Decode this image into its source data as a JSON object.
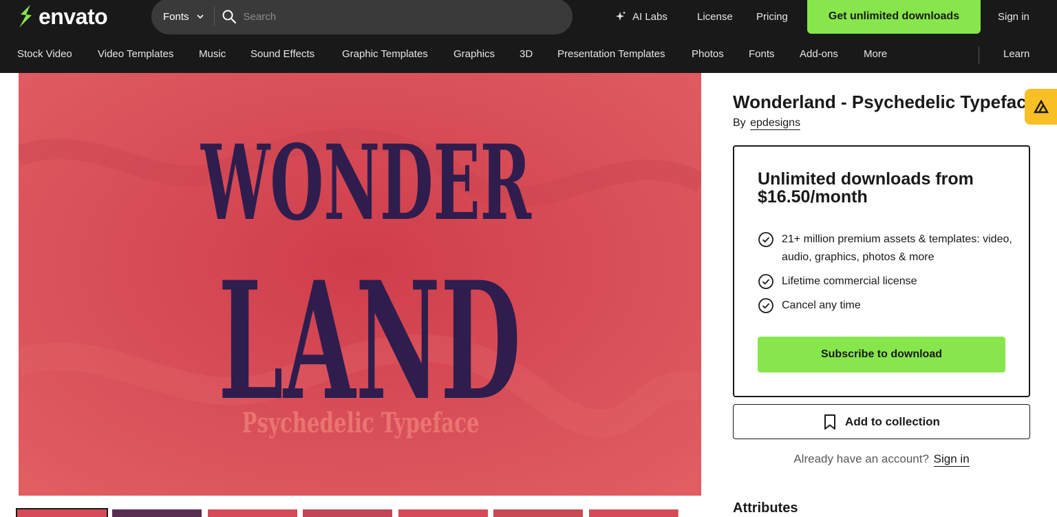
{
  "header": {
    "logo_text": "envato",
    "search": {
      "category": "Fonts",
      "placeholder": "Search"
    },
    "ai_labs_label": "AI Labs",
    "license_label": "License",
    "pricing_label": "Pricing",
    "cta_label": "Get unlimited downloads",
    "signin_label": "Sign in",
    "brand_color": "#87e64b",
    "bar_color": "#191919"
  },
  "categories": [
    "Stock Video",
    "Video Templates",
    "Music",
    "Sound Effects",
    "Graphic Templates",
    "Graphics",
    "3D",
    "Presentation Templates",
    "Photos",
    "Fonts",
    "Add-ons",
    "More"
  ],
  "learn_label": "Learn",
  "preview": {
    "line1": "WONDER",
    "line2": "LAND",
    "tagline": "Psychedelic Typeface",
    "background_color": "#d94a55",
    "text_color": "#2f1d4e",
    "tagline_color": "#ea7470"
  },
  "item": {
    "title": "Wonderland - Psychedelic Typeface",
    "by_label": "By",
    "author": "epdesigns"
  },
  "subscription": {
    "headline": "Unlimited downloads from $16.50/month",
    "features": [
      "21+ million premium assets & templates: video, audio, graphics, photos & more",
      "Lifetime commercial license",
      "Cancel any time"
    ],
    "button_label": "Subscribe to download"
  },
  "collection_label": "Add to collection",
  "account": {
    "prompt": "Already have an account?",
    "signin_label": "Sign in"
  },
  "attributes_heading": "Attributes"
}
